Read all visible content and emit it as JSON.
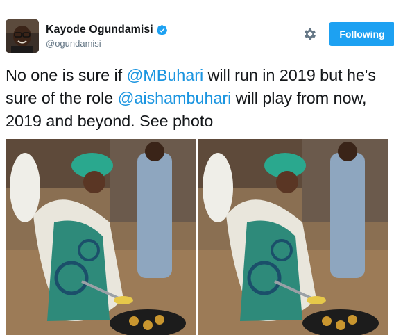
{
  "user": {
    "display_name": "Kayode Ogundamisi",
    "handle": "@ogundamisi",
    "verified": true,
    "verified_icon": "verified-badge-icon"
  },
  "actions": {
    "settings_icon": "gear-icon",
    "follow_label": "Following"
  },
  "tweet": {
    "segments": [
      {
        "text": "No one is sure if ",
        "type": "text"
      },
      {
        "text": "@MBuhari",
        "type": "mention"
      },
      {
        "text": " will run in 2019 but he's sure of the role ",
        "type": "text"
      },
      {
        "text": "@aishambuhari",
        "type": "mention"
      },
      {
        "text": " will play from now, 2019 and beyond. See photo",
        "type": "text"
      }
    ]
  },
  "media": {
    "count": 2
  },
  "colors": {
    "accent": "#1da1f2",
    "mention": "#1b95e0",
    "text": "#14171a",
    "secondary": "#657786"
  }
}
